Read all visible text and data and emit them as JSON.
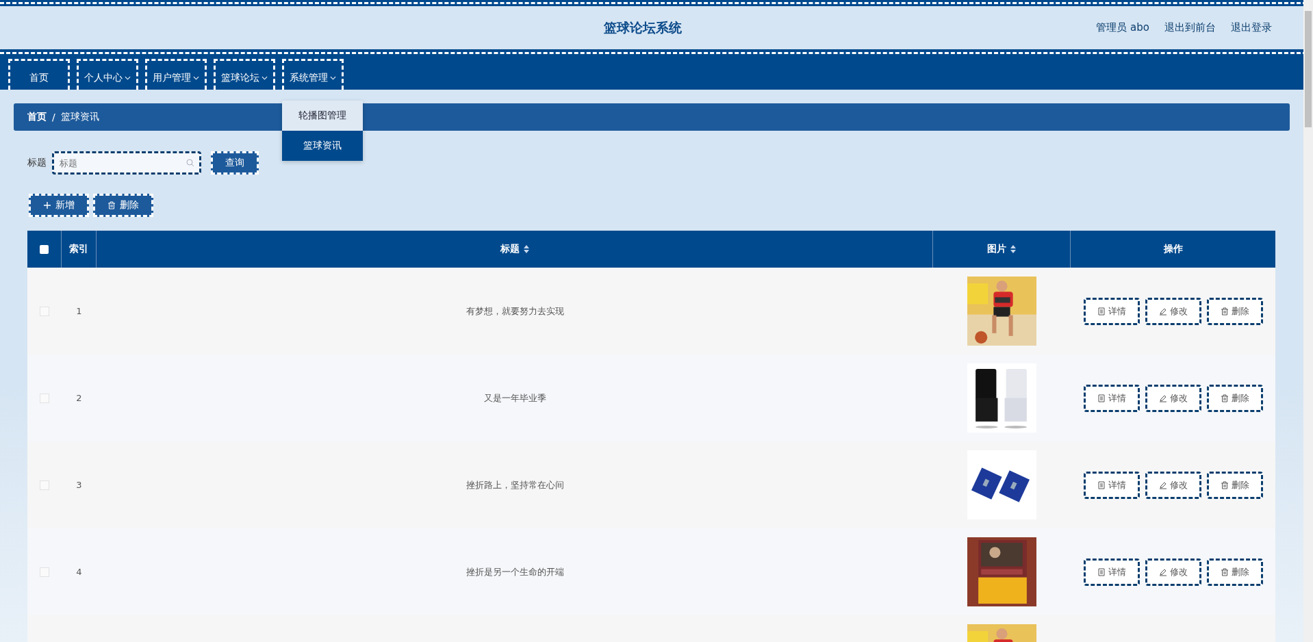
{
  "header": {
    "title": "篮球论坛系统",
    "links": [
      "管理员 abo",
      "退出到前台",
      "退出登录"
    ]
  },
  "nav": [
    {
      "label": "首页",
      "has_menu": false
    },
    {
      "label": "个人中心",
      "has_menu": true
    },
    {
      "label": "用户管理",
      "has_menu": true
    },
    {
      "label": "篮球论坛",
      "has_menu": true
    },
    {
      "label": "系统管理",
      "has_menu": true,
      "menu": [
        {
          "label": "轮播图管理",
          "selected": false
        },
        {
          "label": "篮球资讯",
          "selected": true
        }
      ]
    }
  ],
  "breadcrumb": [
    "首页",
    "/",
    "篮球资讯"
  ],
  "search": {
    "label": "标题",
    "placeholder": "标题",
    "button": "查询"
  },
  "actions": [
    "新增",
    "删除"
  ],
  "table": {
    "columns": [
      {
        "kind": "checkbox",
        "checked": false
      },
      {
        "kind": "text",
        "label": "索引",
        "sortable": false
      },
      {
        "kind": "text",
        "label": "标题",
        "sortable": true
      },
      {
        "kind": "text",
        "label": "图片",
        "sortable": true
      },
      {
        "kind": "text",
        "label": "操作",
        "sortable": false
      }
    ],
    "rows": [
      {
        "kind": "entry",
        "checked": false,
        "index": "1",
        "title": "有梦想，就要努力去实现",
        "actions": [
          "详情",
          "修改",
          "删除"
        ]
      },
      {
        "kind": "entry",
        "checked": false,
        "index": "2",
        "title": "又是一年毕业季",
        "actions": [
          "详情",
          "修改",
          "删除"
        ]
      },
      {
        "kind": "entry",
        "checked": false,
        "index": "3",
        "title": "挫折路上，坚持常在心间",
        "actions": [
          "详情",
          "修改",
          "删除"
        ]
      },
      {
        "kind": "entry",
        "checked": false,
        "index": "4",
        "title": "挫折是另一个生命的开端",
        "actions": [
          "详情",
          "修改",
          "删除"
        ]
      },
      {
        "kind": "picture"
      }
    ]
  }
}
